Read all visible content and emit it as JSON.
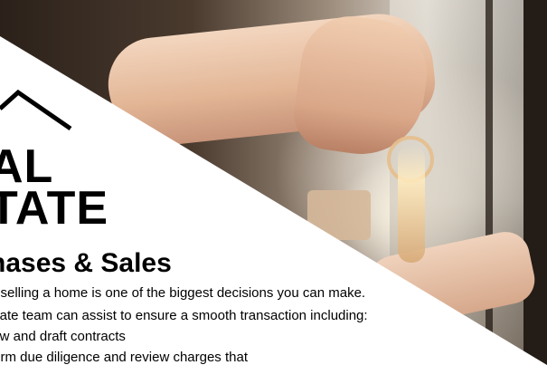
{
  "logo": {
    "line1": "AL",
    "line2": "TATE"
  },
  "heading": "hases & Sales",
  "body": {
    "line1": "d selling a home is one of the biggest decisions you can make.",
    "line2": "state team can assist to ensure a smooth transaction including:",
    "line3": "iew and draft contracts",
    "line4": "form due diligence and review charges that"
  },
  "colors": {
    "overlay": "#ffffff",
    "text": "#000000"
  },
  "icons": {
    "logo_mark": "house-roof-icon"
  }
}
